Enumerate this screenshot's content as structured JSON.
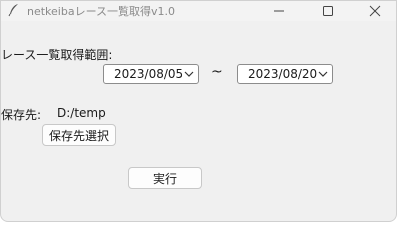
{
  "window": {
    "title": "netkeibaレース一覧取得v1.0"
  },
  "range": {
    "label": "レース一覧取得範囲:",
    "start_date": "2023/08/05",
    "separator": "~",
    "end_date": "2023/08/20"
  },
  "save": {
    "label": "保存先:",
    "path": "D:/temp",
    "select_button_label": "保存先選択"
  },
  "actions": {
    "run_button_label": "実行"
  },
  "icons": {
    "app": "feather-icon",
    "minimize": "minimize-icon",
    "maximize": "maximize-icon",
    "close": "close-icon",
    "dropdown": "chevron-down-icon"
  }
}
